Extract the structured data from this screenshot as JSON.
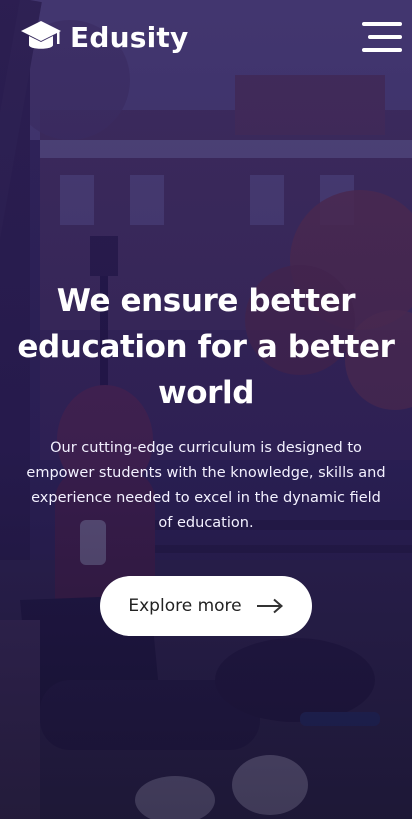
{
  "brand": {
    "name": "Edusity",
    "logo_icon": "graduation-cap-icon"
  },
  "nav": {
    "menu_icon": "hamburger-menu-icon"
  },
  "hero": {
    "headline": "We ensure better education for a better world",
    "description": "Our cutting-edge curriculum is designed to empower students with the knowledge, skills and experience needed to excel in the dynamic field of education.",
    "cta_label": "Explore more",
    "cta_icon": "arrow-right-icon"
  },
  "colors": {
    "overlay": "#2a1860",
    "cta_background": "#ffffff",
    "text": "#ffffff"
  }
}
